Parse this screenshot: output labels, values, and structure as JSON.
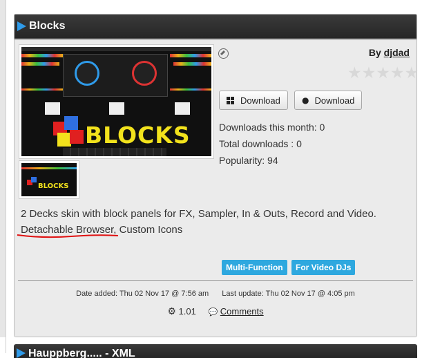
{
  "card": {
    "title": "Blocks",
    "preview_logo": "BLOCKS",
    "author_prefix": "By",
    "author_name": "djdad",
    "rating": 0,
    "download_windows_label": "Download",
    "download_mac_label": "Download",
    "downloads_month": "Downloads this month: 0",
    "total_downloads": "Total downloads : 0",
    "popularity": "Popularity: 94",
    "description_line1": "2 Decks skin with block panels for FX, Sampler, In & Outs, Record and Video.",
    "description_line2": "Detachable Browser, Custom Icons",
    "tags": [
      "Multi-Function",
      "For Video DJs"
    ],
    "date_added": "Date added: Thu 02 Nov 17 @ 7:56 am",
    "last_update": "Last update: Thu 02 Nov 17 @ 4:05 pm",
    "version": "1.01",
    "comments_label": "Comments"
  },
  "next_card": {
    "title": "Hauppberg..... - XML"
  },
  "colors": {
    "accent": "#2f9bea",
    "tag_bg": "#2ea8df",
    "header_bg": "#2b2b2b",
    "annotation_red": "#e01010"
  }
}
